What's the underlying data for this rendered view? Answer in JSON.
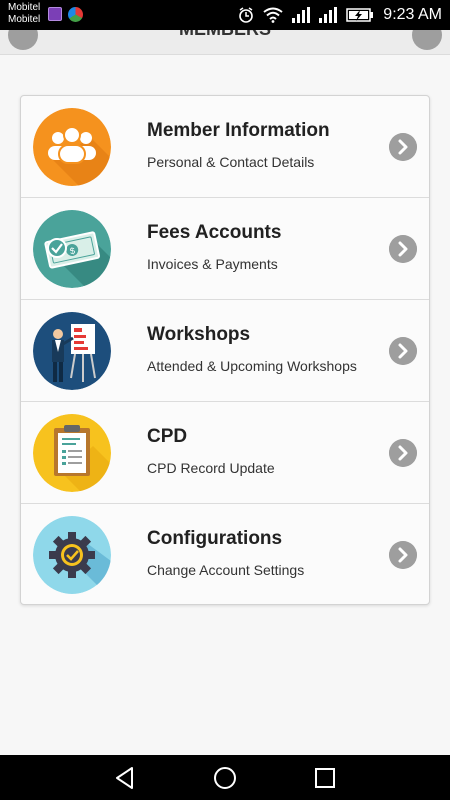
{
  "status_bar": {
    "carrier_line1": "Mobitel",
    "carrier_line2": "Mobitel",
    "time": "9:23 AM"
  },
  "app_bar": {
    "title": "MEMBERS"
  },
  "menu": [
    {
      "title": "Member Information",
      "subtitle": "Personal & Contact Details",
      "icon": "members-icon",
      "color": "#f5921e"
    },
    {
      "title": "Fees Accounts",
      "subtitle": "Invoices & Payments",
      "icon": "money-icon",
      "color": "#4aa39a"
    },
    {
      "title": "Workshops",
      "subtitle": "Attended & Upcoming Workshops",
      "icon": "presentation-icon",
      "color": "#1d4e7c"
    },
    {
      "title": "CPD",
      "subtitle": "CPD Record Update",
      "icon": "clipboard-icon",
      "color": "#f7c21e"
    },
    {
      "title": "Configurations",
      "subtitle": "Change Account Settings",
      "icon": "gear-icon",
      "color": "#8fd8ea"
    }
  ]
}
